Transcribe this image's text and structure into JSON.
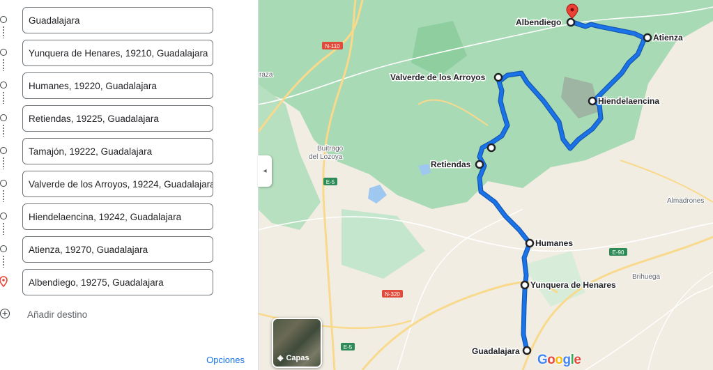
{
  "sidebar": {
    "stops": [
      {
        "value": "Guadalajara"
      },
      {
        "value": "Yunquera de Henares, 19210, Guadalajara"
      },
      {
        "value": "Humanes, 19220, Guadalajara"
      },
      {
        "value": "Retiendas, 19225, Guadalajara"
      },
      {
        "value": "Tamajón, 19222, Guadalajara"
      },
      {
        "value": "Valverde de los Arroyos, 19224, Guadalajara"
      },
      {
        "value": "Hiendelaencina, 19242, Guadalajara"
      },
      {
        "value": "Atienza, 19270, Guadalajara"
      },
      {
        "value": "Albendiego, 19275, Guadalajara"
      }
    ],
    "add_destination": "Añadir destino",
    "options": "Opciones"
  },
  "map": {
    "places": {
      "albendiego": "Albendiego",
      "atienza": "Atienza",
      "valverde": "Valverde de los Arroyos",
      "hiendelaencina": "Hiendelaencina",
      "retiendas": "Retiendas",
      "humanes": "Humanes",
      "yunquera": "Yunquera de Henares",
      "guadalajara": "Guadalajara",
      "buitrago_1": "Buitrago",
      "buitrago_2": "del Lozoya",
      "almadrones": "Almadrones",
      "brihuega": "Brihuega",
      "raza": "raza"
    },
    "roads": {
      "n110": "N-110",
      "e5_top": "E-5",
      "e5_bottom": "E-5",
      "n320": "N-320",
      "e90": "E-90"
    },
    "layers_label": "Capas",
    "logo": [
      "G",
      "o",
      "o",
      "g",
      "l",
      "e"
    ],
    "colors": {
      "route": "#1a73e8",
      "route_outline": "#1558b0",
      "forest": "#a8dab5",
      "land": "#f1ede3",
      "road": "#f9d98b",
      "pin": "#ea4335"
    }
  }
}
